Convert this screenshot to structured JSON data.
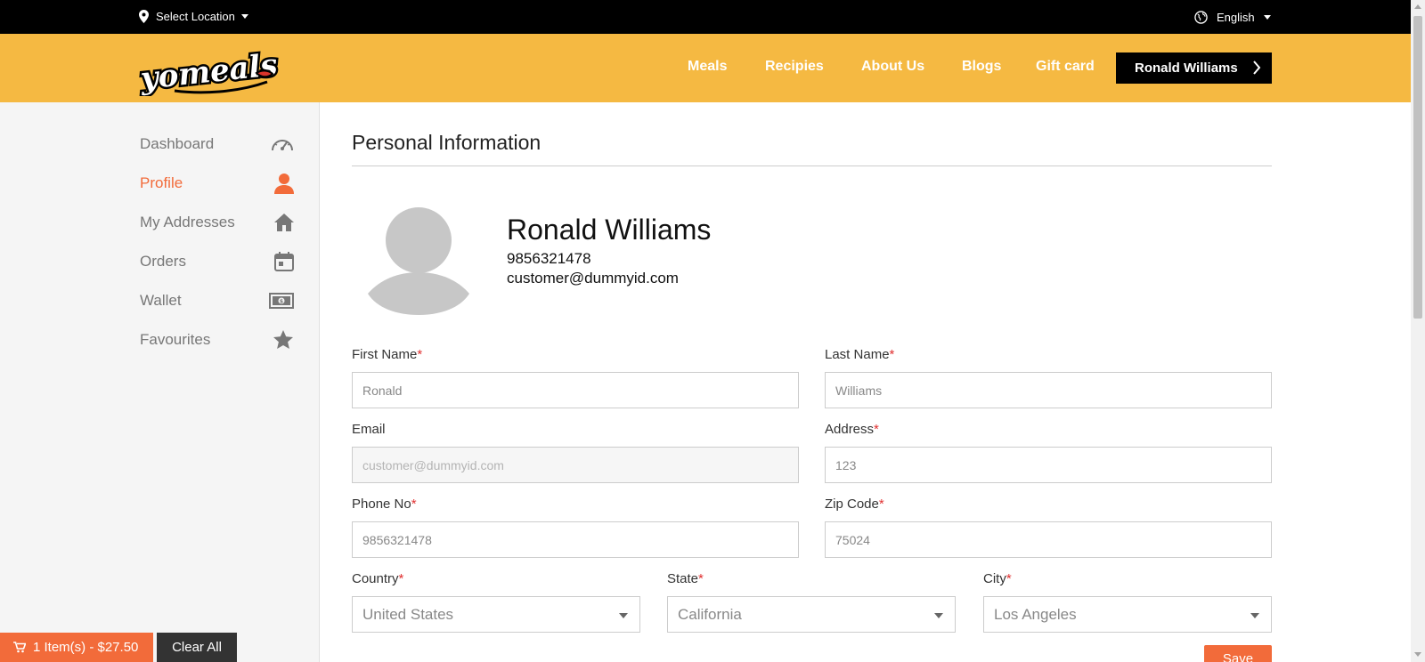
{
  "topbar": {
    "location_label": "Select Location",
    "language_label": "English"
  },
  "header": {
    "logo_text": "yomeals",
    "nav": [
      "Meals",
      "Recipies",
      "About Us",
      "Blogs",
      "Gift card"
    ],
    "user_button": "Ronald Williams"
  },
  "sidebar": {
    "items": [
      {
        "label": "Dashboard",
        "icon": "speedometer-icon",
        "active": false
      },
      {
        "label": "Profile",
        "icon": "person-icon",
        "active": true
      },
      {
        "label": "My Addresses",
        "icon": "home-icon",
        "active": false
      },
      {
        "label": "Orders",
        "icon": "calendar-icon",
        "active": false
      },
      {
        "label": "Wallet",
        "icon": "money-icon",
        "active": false
      },
      {
        "label": "Favourites",
        "icon": "star-icon",
        "active": false
      }
    ]
  },
  "main": {
    "title": "Personal Information",
    "profile": {
      "name": "Ronald Williams",
      "phone": "9856321478",
      "email": "customer@dummyid.com"
    },
    "form": {
      "first_name": {
        "label": "First Name",
        "value": "Ronald"
      },
      "last_name": {
        "label": "Last Name",
        "value": "Williams"
      },
      "email": {
        "label": "Email",
        "value": "customer@dummyid.com"
      },
      "address": {
        "label": "Address",
        "value": "123"
      },
      "phone": {
        "label": "Phone No",
        "value": "9856321478"
      },
      "zip": {
        "label": "Zip Code",
        "value": "75024"
      },
      "country": {
        "label": "Country",
        "value": "United States"
      },
      "state": {
        "label": "State",
        "value": "California"
      },
      "city": {
        "label": "City",
        "value": "Los Angeles"
      },
      "required_mark": "*"
    },
    "save_label": "Save"
  },
  "cart": {
    "summary": "1 Item(s) - $27.50",
    "clear_label": "Clear All"
  },
  "colors": {
    "brand_yellow": "#F5B942",
    "accent_orange": "#F26B3A",
    "topbar": "#000000"
  }
}
